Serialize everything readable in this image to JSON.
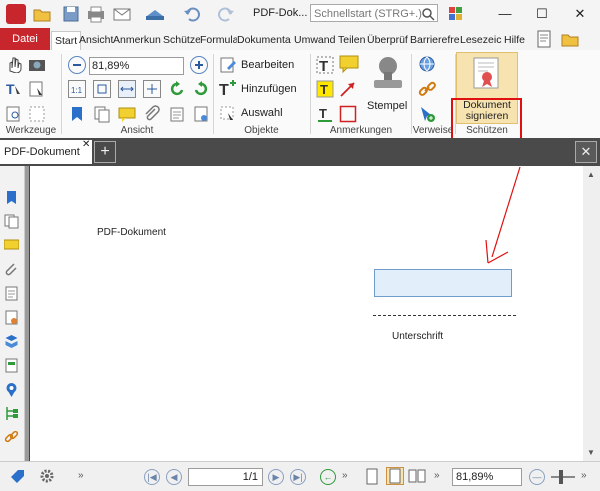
{
  "titlebar": {
    "title": "PDF-Dok...",
    "search_placeholder": "Schnellstart (STRG+.)"
  },
  "tabs": {
    "datei": "Datei",
    "items": [
      "Start",
      "Ansicht",
      "Anmerkun",
      "Schütze",
      "Formula",
      "Dokumenta",
      "Umwand",
      "Teilen",
      "Überprüf",
      "Barrierefre",
      "Lesezeich",
      "Hilfe"
    ]
  },
  "ribbon": {
    "zoom_value": "81,89%",
    "bearbeiten": "Bearbeiten",
    "hinzufuegen": "Hinzufügen",
    "auswahl": "Auswahl",
    "stempel": "Stempel",
    "dokument_signieren_1": "Dokument",
    "dokument_signieren_2": "signieren",
    "groups": {
      "werkzeuge": "Werkzeuge",
      "ansicht": "Ansicht",
      "objekte": "Objekte",
      "anmerkungen": "Anmerkungen",
      "verweise": "Verweise",
      "schuetzen": "Schützen"
    }
  },
  "doctab": {
    "label": "PDF-Dokument"
  },
  "document": {
    "heading": "PDF-Dokument",
    "signature_label": "Unterschrift"
  },
  "statusbar": {
    "page_indicator": "1/1",
    "zoom_value": "81,89%"
  },
  "colors": {
    "datei_red": "#c8262d",
    "highlight_red": "#e01010",
    "signature_field_fill": "#e2eefa"
  }
}
